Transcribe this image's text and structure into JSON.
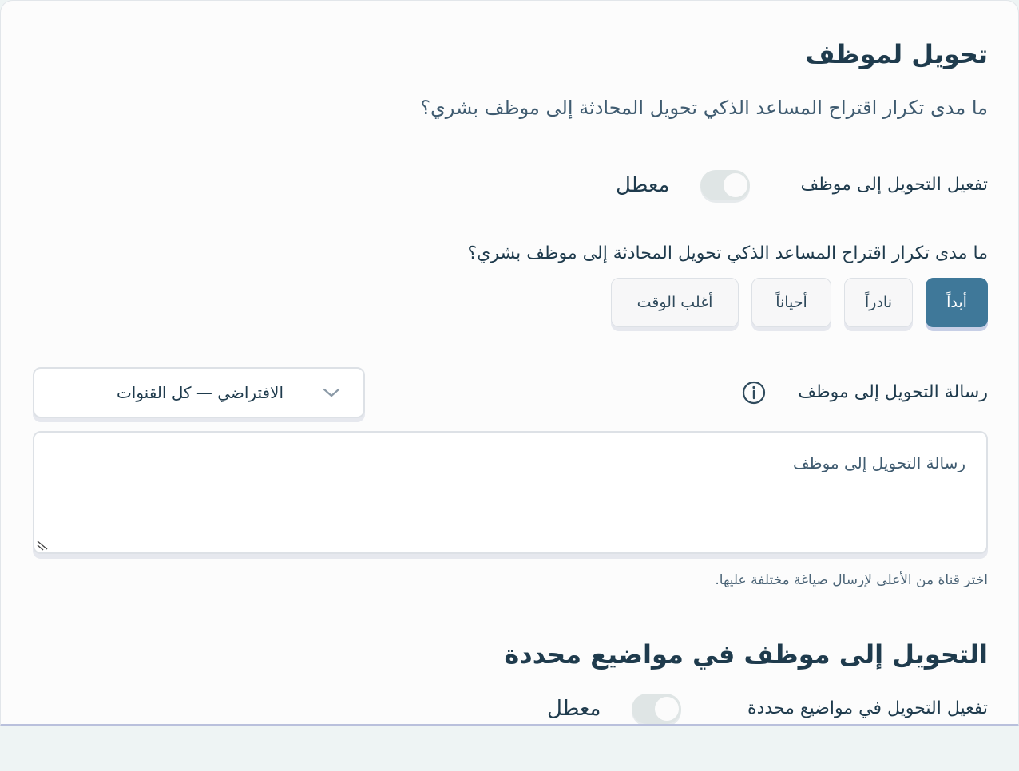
{
  "handoff": {
    "title": "تحويل لموظف",
    "subtitle": "ما مدى تكرار اقتراح المساعد الذكي تحويل المحادثة إلى موظف بشري؟",
    "enable_label": "تفعيل التحويل إلى موظف",
    "enable_status": "معطل",
    "enabled": false,
    "frequency_question": "ما مدى تكرار اقتراح المساعد الذكي تحويل المحادثة إلى موظف بشري؟",
    "frequency_options": [
      "أبداً",
      "نادراً",
      "أحياناً",
      "أغلب الوقت"
    ],
    "frequency_selected": "أبداً",
    "message_label": "رسالة التحويل إلى موظف",
    "channel_select_value": "الافتراضي — كل القنوات",
    "message_placeholder": "رسالة التحويل إلى موظف",
    "channel_hint": "اختر قناة من الأعلى لإرسال صياغة مختلفة عليها."
  },
  "topics": {
    "title": "التحويل إلى موظف في مواضيع محددة",
    "enable_label": "تفعيل التحويل في مواضيع محددة",
    "enable_status": "معطل",
    "enabled": false
  },
  "colors": {
    "accent": "#3f7899",
    "text": "#1f3b4d",
    "toggle_off": "#dfe5e5"
  }
}
